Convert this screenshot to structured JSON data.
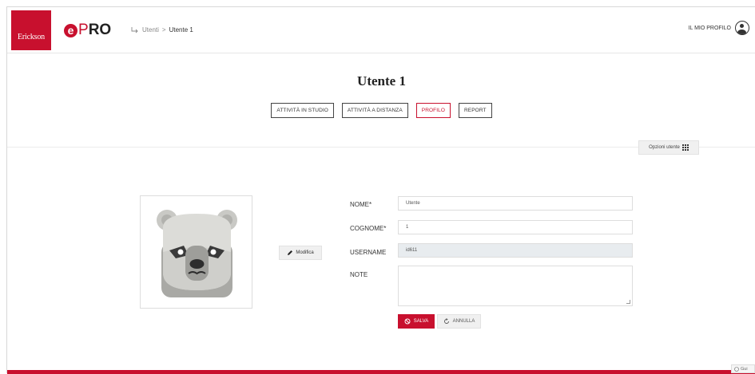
{
  "brand": {
    "publisher": "Erickson",
    "app_e": "e",
    "app_p": "P",
    "app_ro": "RO"
  },
  "breadcrumb": {
    "parent": "Utenti",
    "separator": ">",
    "current": "Utente 1"
  },
  "header": {
    "profile_label": "IL MIO PROFILO"
  },
  "page": {
    "title": "Utente 1"
  },
  "tabs": [
    {
      "label": "ATTIVITÀ IN STUDIO",
      "active": false
    },
    {
      "label": "ATTIVITÀ A DISTANZA",
      "active": false
    },
    {
      "label": "PROFILO",
      "active": true
    },
    {
      "label": "REPORT",
      "active": false
    }
  ],
  "options_button": {
    "label": "Opzioni utente"
  },
  "avatar": {
    "icon": "polar-bear-avatar",
    "edit_label": "Modifica"
  },
  "form": {
    "nome_label": "NOME*",
    "nome_value": "Utente",
    "cognome_label": "COGNOME*",
    "cognome_value": "1",
    "username_label": "USERNAME",
    "username_value": "id611",
    "note_label": "NOTE",
    "note_value": ""
  },
  "actions": {
    "save_label": "SALVA",
    "cancel_label": "ANNULLA"
  },
  "footer": {
    "guide_label": "Gui"
  },
  "colors": {
    "accent": "#c8102e",
    "readonly_bg": "#e8ecef"
  }
}
